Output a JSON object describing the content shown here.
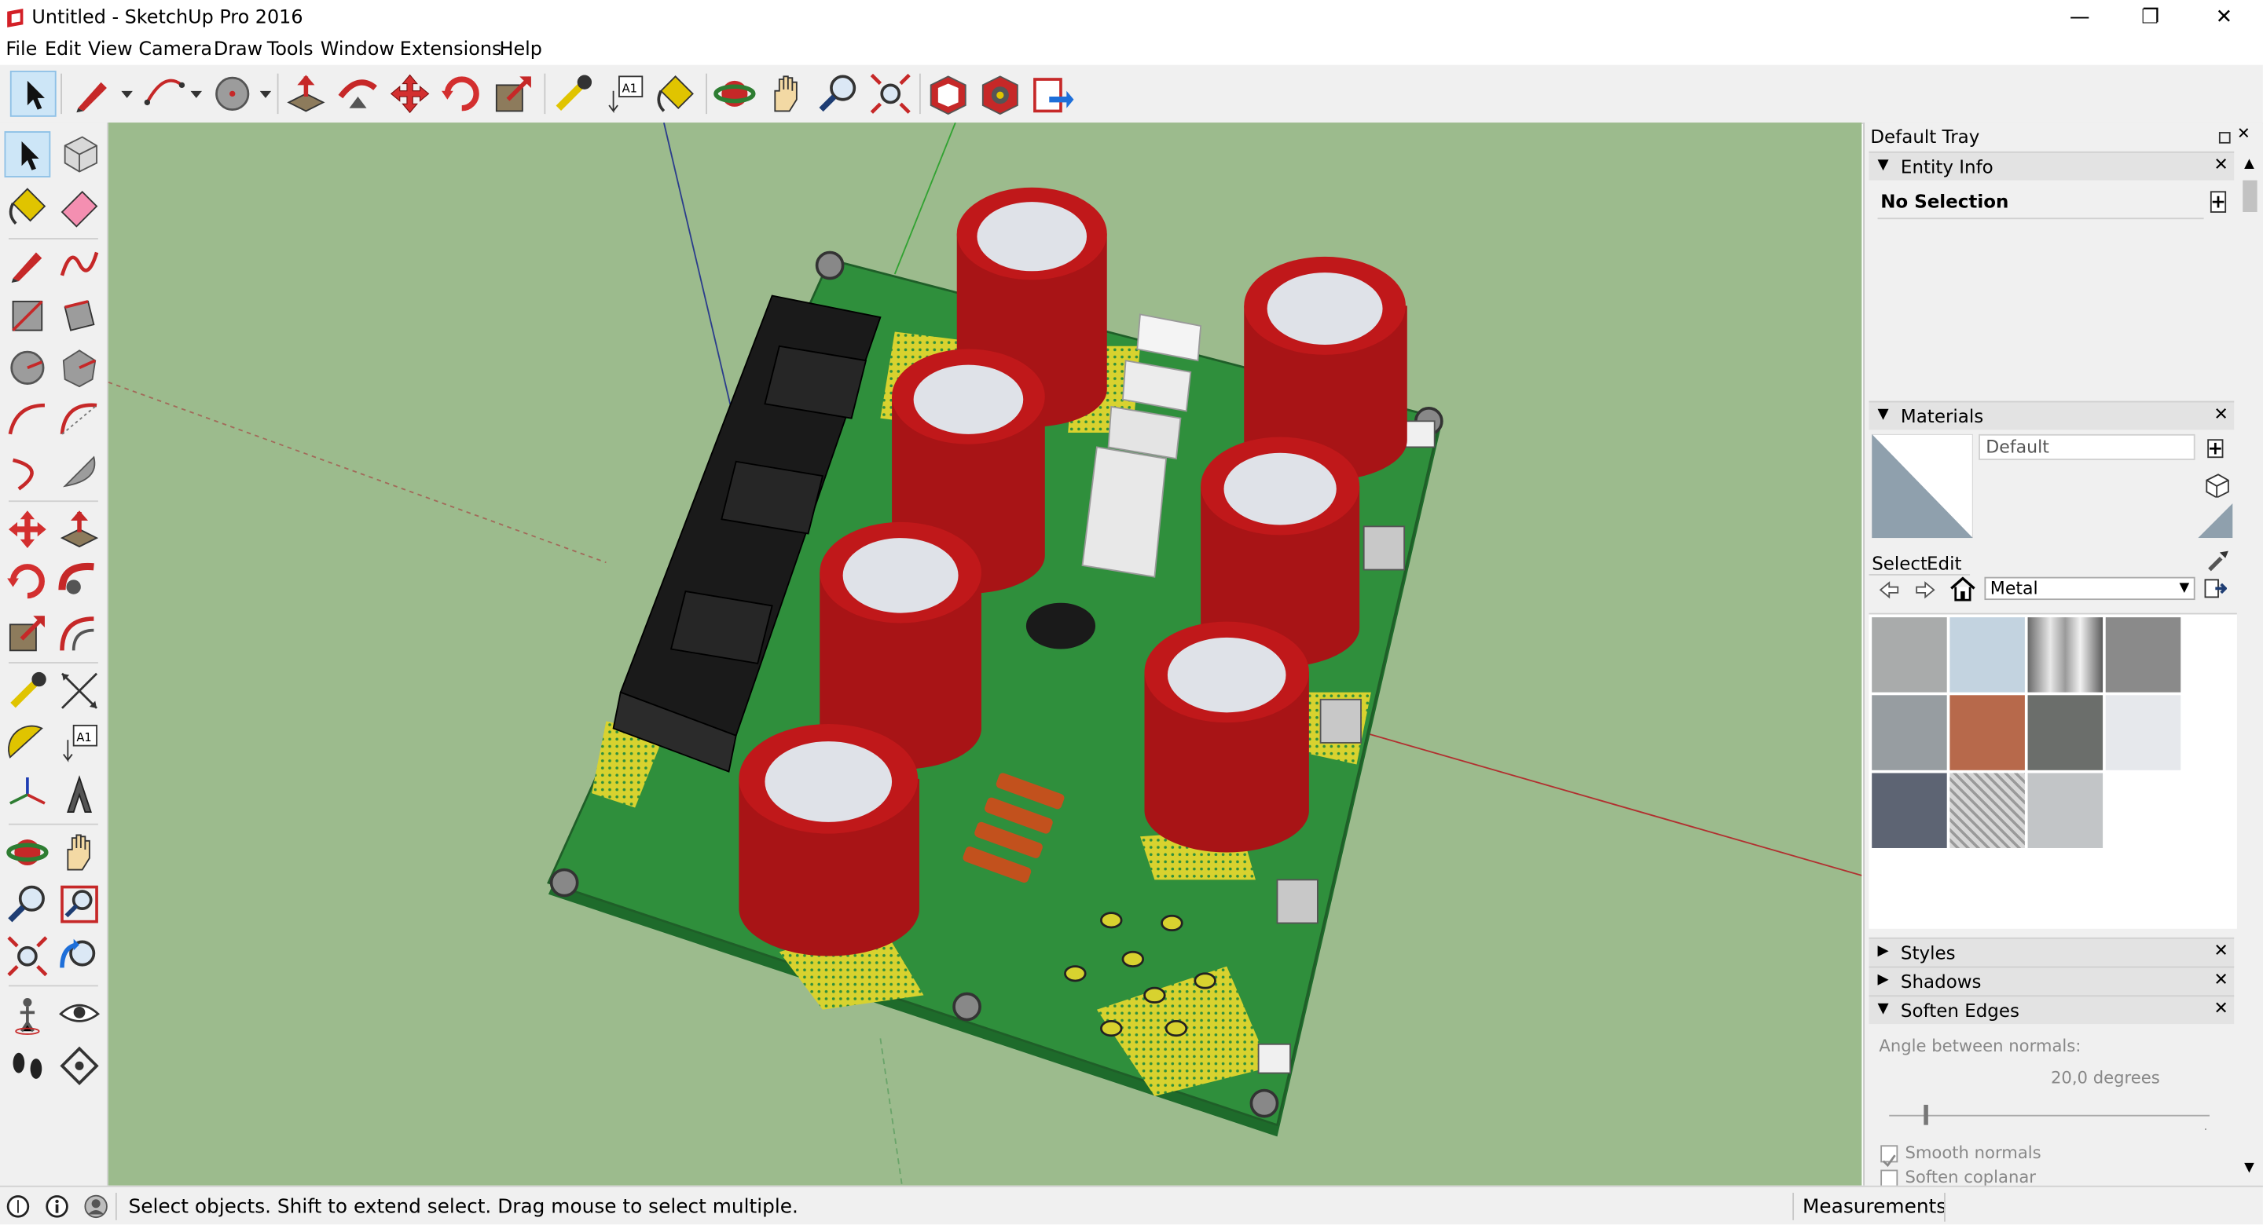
{
  "window": {
    "title": "Untitled - SketchUp Pro 2016",
    "minimize_glyph": "—",
    "restore_glyph": "❐",
    "close_glyph": "✕"
  },
  "menu": [
    "File",
    "Edit",
    "View",
    "Camera",
    "Draw",
    "Tools",
    "Window",
    "Extensions",
    "Help"
  ],
  "toolbar_icons": [
    "select-icon",
    "pencil-line-icon",
    "arc-icon",
    "circle-icon",
    "push-pull-icon",
    "follow-me-icon",
    "move-icon",
    "rotate-icon",
    "scale-icon",
    "tape-measure-icon",
    "text-icon",
    "paint-bucket-icon",
    "orbit-icon",
    "pan-icon",
    "zoom-icon",
    "zoom-extents-icon",
    "warehouse-icon",
    "extension-warehouse-icon",
    "send-to-layout-icon"
  ],
  "left_toolbar_icons": [
    "select-icon",
    "component-icon",
    "paint-bucket-icon",
    "eraser-icon",
    "line-icon",
    "freehand-icon",
    "rectangle-icon",
    "rotated-rectangle-icon",
    "circle-icon",
    "polygon-icon",
    "arc-icon",
    "two-point-arc-icon",
    "three-point-arc-icon",
    "pie-icon",
    "move-icon",
    "push-pull-icon",
    "rotate-icon",
    "follow-me-icon",
    "scale-icon",
    "offset-icon",
    "tape-measure-icon",
    "dimension-icon",
    "protractor-icon",
    "text-icon",
    "axes-icon",
    "3d-text-icon",
    "orbit-icon",
    "pan-icon",
    "zoom-icon",
    "zoom-window-icon",
    "zoom-extents-icon",
    "previous-view-icon",
    "position-camera-icon",
    "look-around-icon",
    "walk-icon",
    "section-plane-icon"
  ],
  "tray": {
    "title": "Default Tray",
    "entity_info": {
      "label": "Entity Info",
      "value": "No Selection"
    },
    "materials": {
      "label": "Materials",
      "current_name": "Default",
      "tab_select": "Select",
      "tab_edit": "Edit",
      "library": "Metal",
      "swatch_colors": [
        "#a9abab",
        "#c3d3e0",
        "#9a9a9a",
        "#8a8a8a",
        "#979da1",
        "#b7694b",
        "#6b6e6b",
        "#e6e8ec",
        "#5d6473",
        "#bdbdbd",
        "#c2c5c7"
      ]
    },
    "styles": {
      "label": "Styles"
    },
    "shadows": {
      "label": "Shadows"
    },
    "soften": {
      "label": "Soften Edges",
      "angle_label": "Angle between normals:",
      "angle_value": "20,0  degrees",
      "angle_fraction": 0.11,
      "smooth_normals": "Smooth normals",
      "soften_coplanar": "Soften coplanar"
    }
  },
  "status": {
    "message": "Select objects. Shift to extend select. Drag mouse to select multiple.",
    "measurements": "Measurements"
  },
  "colors": {
    "viewport_bg": "#9cbb8d",
    "pcb_green": "#2f8f3c",
    "capacitor_red": "#a81416",
    "pad_yellow": "#d8d22f",
    "selection_blue": "#cde6f7"
  }
}
